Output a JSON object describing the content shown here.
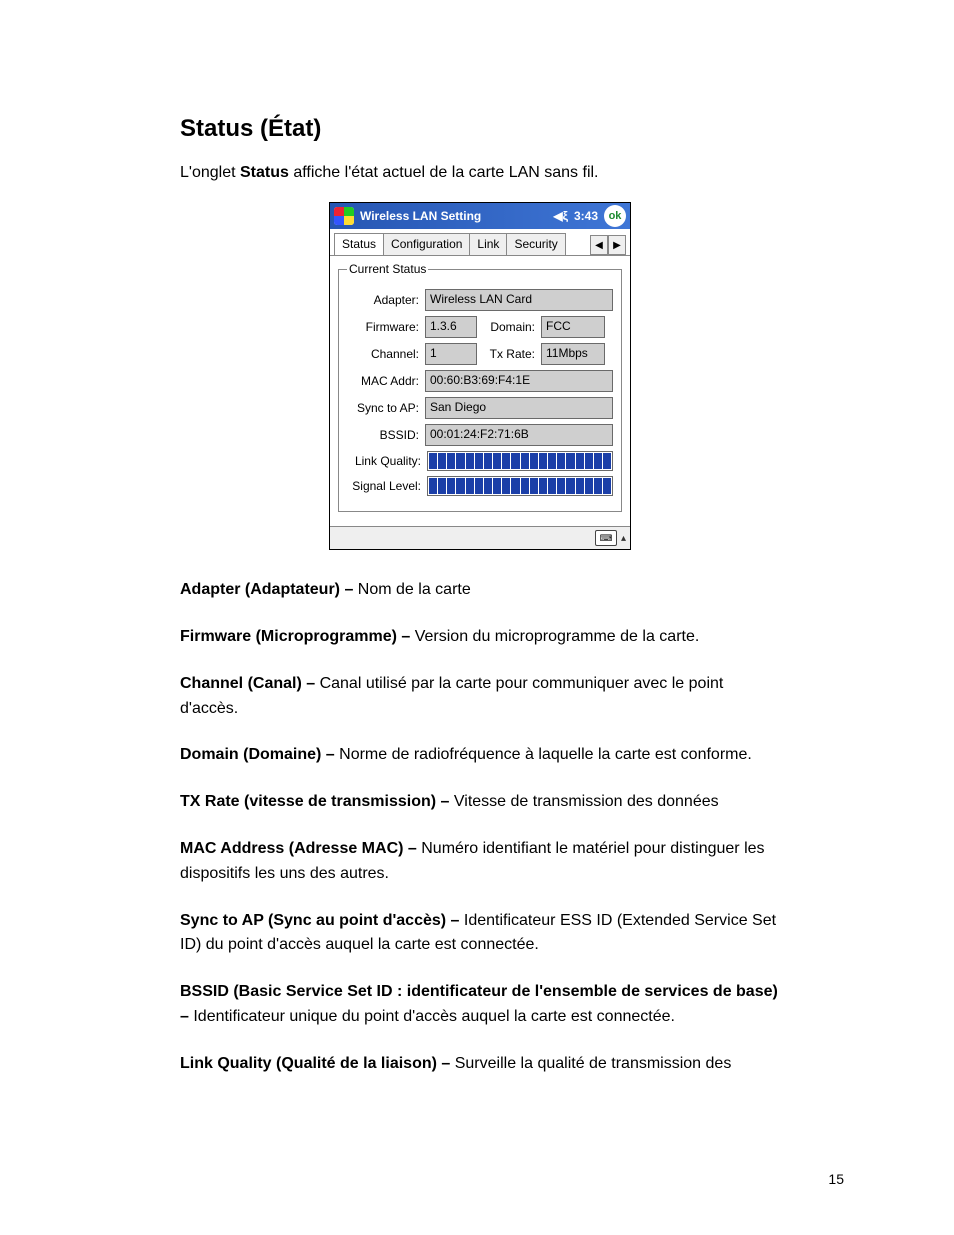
{
  "heading": "Status (État)",
  "intro_pre": "L'onglet ",
  "intro_bold": "Status",
  "intro_post": " affiche l'état actuel de la carte LAN sans fil.",
  "page_number": "15",
  "pda": {
    "title": "Wireless LAN Setting",
    "clock": "3:43",
    "ok": "ok",
    "speaker_icon": "◀ξ",
    "tabs": [
      "Status",
      "Configuration",
      "Link",
      "Security"
    ],
    "arrows": {
      "left": "◀",
      "right": "▶"
    },
    "group_legend": "Current Status",
    "labels": {
      "adapter": "Adapter:",
      "firmware": "Firmware:",
      "domain": "Domain:",
      "channel": "Channel:",
      "txrate": "Tx Rate:",
      "mac": "MAC Addr:",
      "sync": "Sync to AP:",
      "bssid": "BSSID:",
      "linkq": "Link Quality:",
      "signal": "Signal Level:"
    },
    "values": {
      "adapter": "Wireless LAN Card",
      "firmware": "1.3.6",
      "domain": "FCC",
      "channel": "1",
      "txrate": "11Mbps",
      "mac": "00:60:B3:69:F4:1E",
      "sync": "San Diego",
      "bssid": "00:01:24:F2:71:6B"
    },
    "link_quality_segments": 20,
    "signal_level_segments": 20,
    "bottom": {
      "kbd": "⌨",
      "up": "▴"
    }
  },
  "defs": [
    {
      "b": "Adapter (Adaptateur) – ",
      "t": "Nom de la carte"
    },
    {
      "b": "Firmware (Microprogramme) – ",
      "t": "Version du microprogramme de la carte."
    },
    {
      "b": "Channel (Canal) – ",
      "t": "Canal utilisé par la carte pour communiquer avec le point d'accès."
    },
    {
      "b": "Domain (Domaine) – ",
      "t": "Norme de radiofréquence à laquelle la carte est conforme."
    },
    {
      "b": "TX Rate (vitesse de transmission) – ",
      "t": "Vitesse de transmission des données"
    },
    {
      "b": "MAC Address (Adresse MAC) – ",
      "t": "Numéro identifiant le matériel pour distinguer les dispositifs les uns des autres."
    },
    {
      "b": "Sync to AP (Sync au point d'accès) – ",
      "t": "Identificateur ESS ID (Extended Service Set ID) du point d'accès auquel la carte est connectée."
    },
    {
      "b": "BSSID (Basic Service Set ID : identificateur de l'ensemble de services de base) – ",
      "t": "Identificateur unique du point d'accès auquel la carte est connectée."
    },
    {
      "b": "Link Quality (Qualité de la liaison) – ",
      "t": "Surveille la qualité de transmission des"
    }
  ]
}
